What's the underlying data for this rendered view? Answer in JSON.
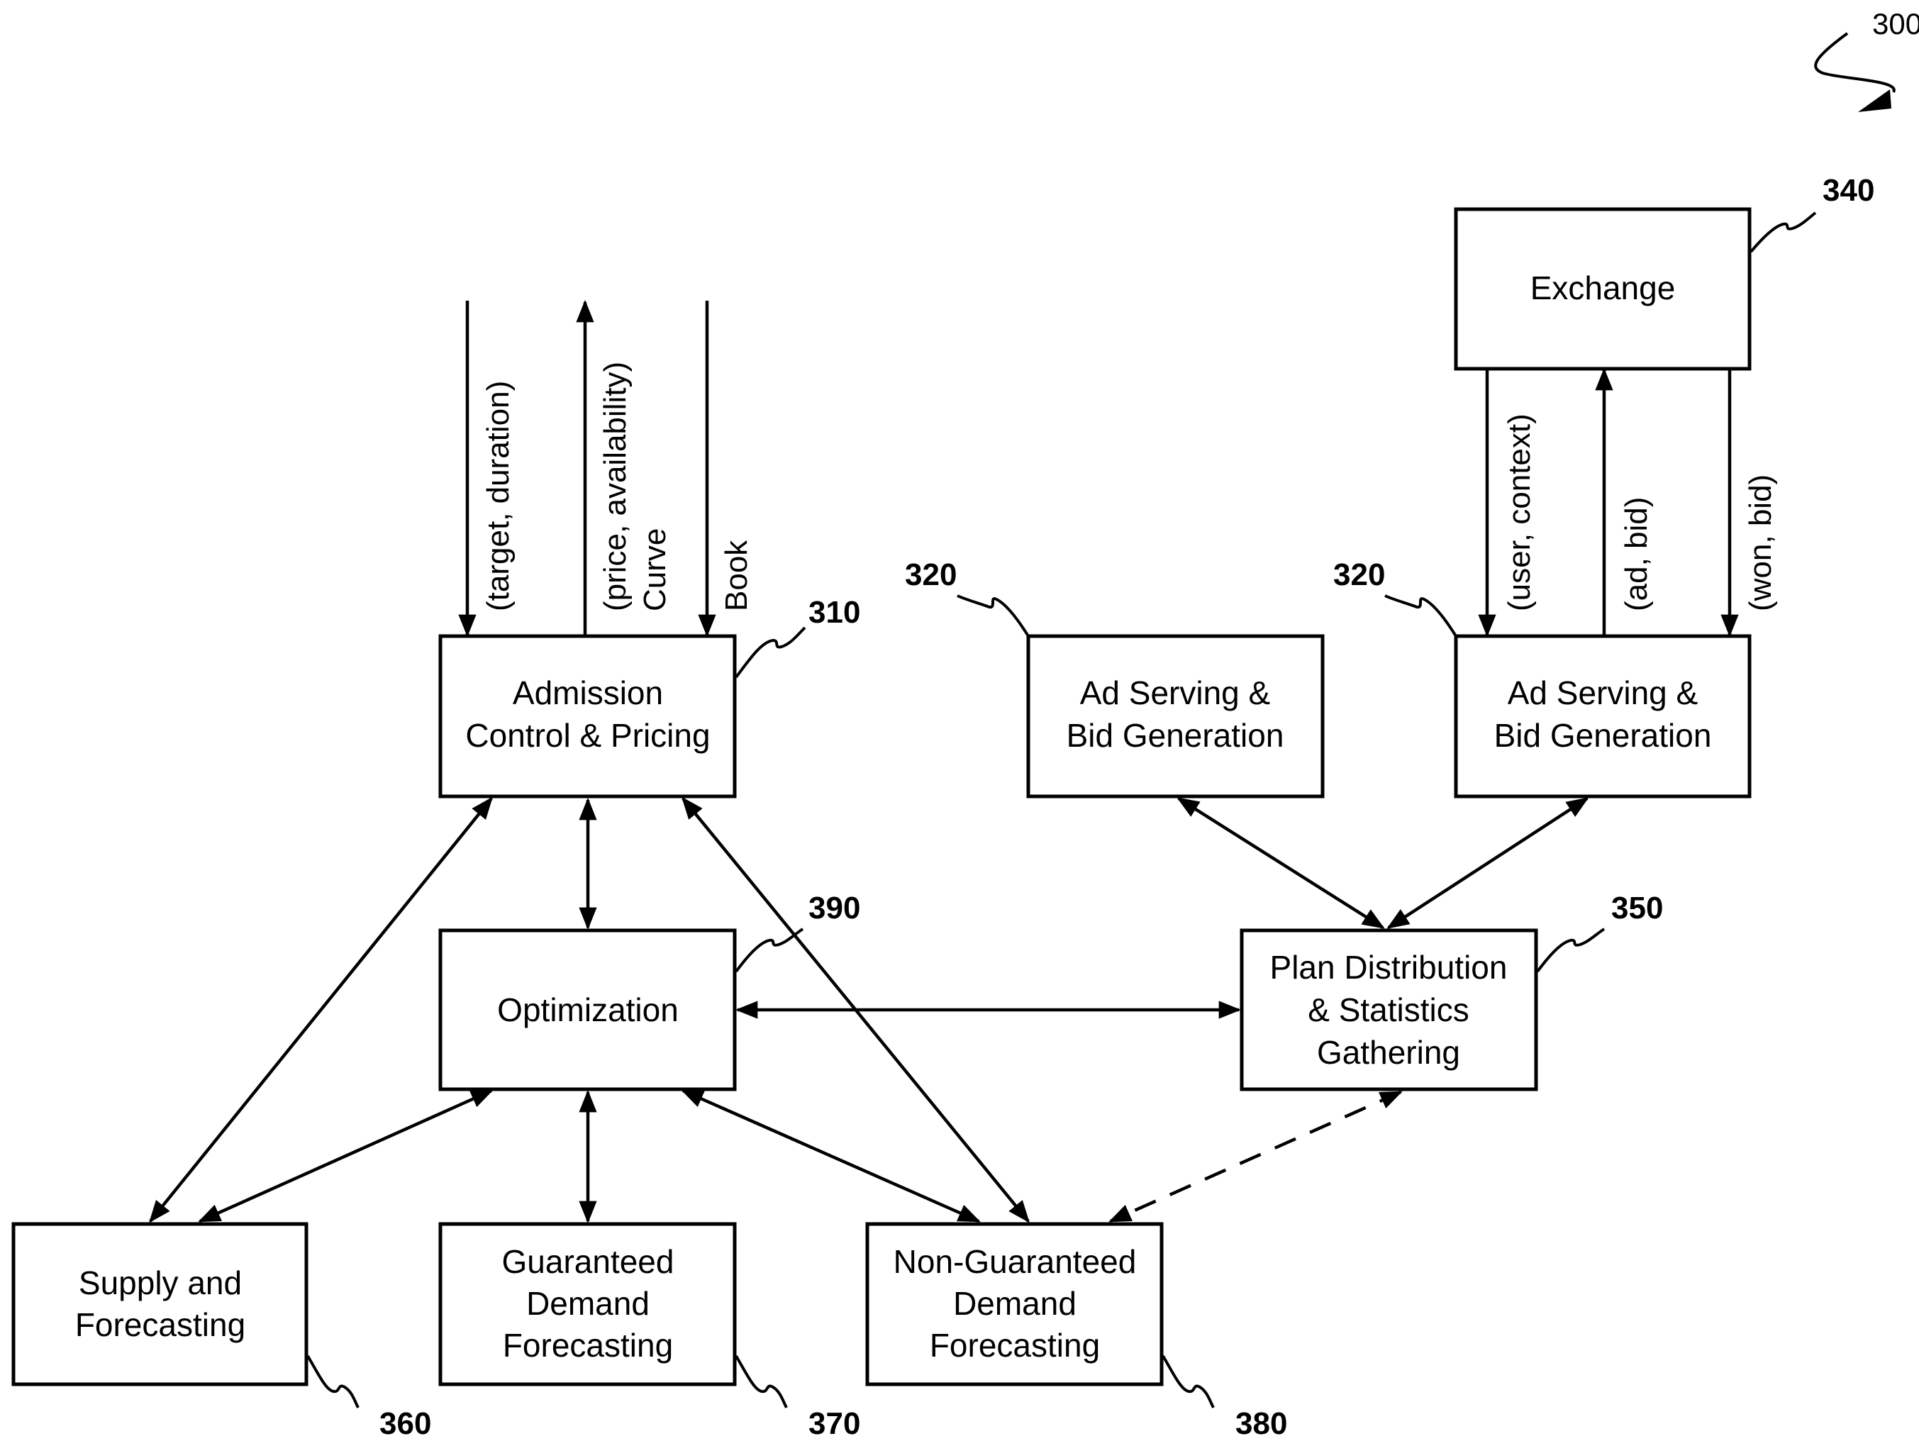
{
  "figure": {
    "ref": "300",
    "color": "#000000"
  },
  "blocks": {
    "admission": {
      "ref": "310",
      "lines": [
        "Admission",
        "Control & Pricing"
      ]
    },
    "ad_serving_1": {
      "ref": "320",
      "lines": [
        "Ad Serving &",
        "Bid Generation"
      ]
    },
    "ad_serving_2": {
      "ref": "320",
      "lines": [
        "Ad Serving &",
        "Bid Generation"
      ]
    },
    "exchange": {
      "ref": "340",
      "lines": [
        "Exchange"
      ]
    },
    "plan_distribution": {
      "ref": "350",
      "lines": [
        "Plan Distribution",
        "& Statistics",
        "Gathering"
      ]
    },
    "supply": {
      "ref": "360",
      "lines": [
        "Supply and",
        "Forecasting"
      ]
    },
    "guaranteed": {
      "ref": "370",
      "lines": [
        "Guaranteed",
        "Demand",
        "Forecasting"
      ]
    },
    "non_guaranteed": {
      "ref": "380",
      "lines": [
        "Non-Guaranteed",
        "Demand",
        "Forecasting"
      ]
    },
    "optimization": {
      "ref": "390",
      "lines": [
        "Optimization"
      ]
    }
  },
  "flows": {
    "target_duration": "(target, duration)",
    "price_availability": "(price, availability)",
    "curve": "Curve",
    "book": "Book",
    "user_context": "(user, context)",
    "ad_bid": "(ad, bid)",
    "won_bid": "(won, bid)"
  }
}
